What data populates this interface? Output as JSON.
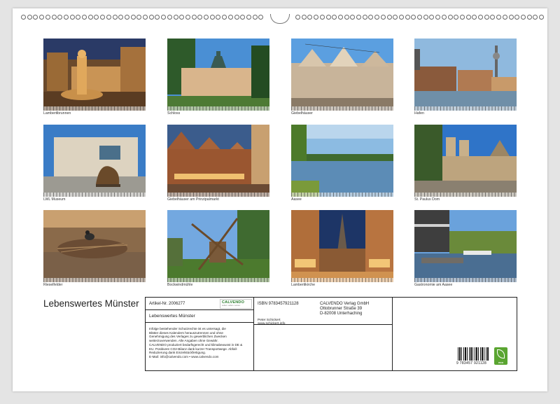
{
  "calendar": {
    "title": "Lebenswertes Münster",
    "photos": [
      {
        "caption": "Lambertibrunnen",
        "scene": "night-fountain"
      },
      {
        "caption": "Schloss",
        "scene": "palace"
      },
      {
        "caption": "Giebelhäuser",
        "scene": "gables-day"
      },
      {
        "caption": "Hafen",
        "scene": "harbour"
      },
      {
        "caption": "LWL Museum",
        "scene": "museum"
      },
      {
        "caption": "Giebelhäuser am Prinzipalmarkt",
        "scene": "gables-evening"
      },
      {
        "caption": "Aasee",
        "scene": "lake"
      },
      {
        "caption": "St. Paulus Dom",
        "scene": "cathedral"
      },
      {
        "caption": "Rieselfelder",
        "scene": "nest"
      },
      {
        "caption": "Bockwindmühle",
        "scene": "windmill"
      },
      {
        "caption": "Lambertikirche",
        "scene": "night-street"
      },
      {
        "caption": "Gastronomie am Aasee",
        "scene": "lakeside-cafe"
      }
    ]
  },
  "info": {
    "article_label": "Artikel-Nr. 2006277",
    "calendar_name": "Lebenswertes Münster",
    "legal_text": [
      "Infolge bestehender Schutzrechte ist es untersagt, die",
      "Blätter dieses Kalenders herauszutrennen und ohne",
      "Genehmigung des Verlages zu gewerblichen Zwecken",
      "weiterzuverwenden. Alle Angaben ohne Gewähr.",
      "CALVENDO produziert bedarfsgerecht und klimabewusst in DE &",
      "EU. Positivere CO2-Bilanz dank kurzer Transportwege. Abfall-",
      "Reduzierung dank Einzelstückfertigung.",
      "E-Mail: info@calvendo.com • www.calvendo.com"
    ],
    "isbn": "ISBN 9783457921128",
    "author": "Peter Schickert",
    "author_url": "www.schickert.info",
    "publisher": [
      "CALVENDO Verlag GmbH",
      "Ottobrunner Straße 39",
      "D-82008 Unterhaching"
    ],
    "logo_text": "CALVENDO",
    "logo_sub": "Leben. Lieben. Lernen.",
    "barcode_number": "9 783457 921128",
    "eco_text": "eco",
    "eco_color": "#5aa531"
  }
}
